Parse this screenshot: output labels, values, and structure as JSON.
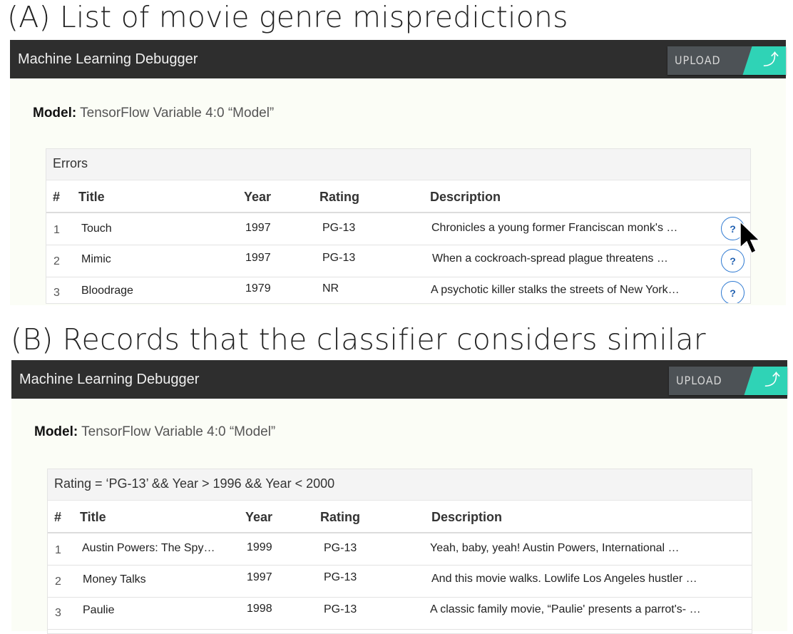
{
  "panels": [
    {
      "caption": "(A) List of movie genre mispredictions",
      "app_title": "Machine Learning Debugger",
      "upload_label": "UPLOAD",
      "upload_icon": "upload-arrow-icon",
      "model_label": "Model:",
      "model_value": "TensorFlow Variable 4:0 “Model”",
      "table": {
        "caption": "Errors",
        "columns": [
          "#",
          "Title",
          "Year",
          "Rating",
          "Description"
        ],
        "rows": [
          {
            "num": "1",
            "title": "Touch",
            "year": "1997",
            "rating": "PG-13",
            "description": "Chronicles a young former Franciscan monk's …",
            "action": "?"
          },
          {
            "num": "2",
            "title": "Mimic",
            "year": "1997",
            "rating": "PG-13",
            "description": "When a cockroach-spread plague threatens …",
            "action": "?"
          },
          {
            "num": "3",
            "title": "Bloodrage",
            "year": "1979",
            "rating": "NR",
            "description": "A psychotic killer stalks the streets of New York…",
            "action": "?"
          }
        ]
      }
    },
    {
      "caption": "(B) Records that the classifier considers similar",
      "app_title": "Machine Learning Debugger",
      "upload_label": "UPLOAD",
      "upload_icon": "upload-arrow-icon",
      "model_label": "Model:",
      "model_value": "TensorFlow Variable 4:0 “Model”",
      "table": {
        "caption": "Rating = ‘PG-13’ && Year > 1996 && Year < 2000",
        "columns": [
          "#",
          "Title",
          "Year",
          "Rating",
          "Description"
        ],
        "rows": [
          {
            "num": "1",
            "title": "Austin Powers: The Spy…",
            "year": "1999",
            "rating": "PG-13",
            "description": "Yeah, baby, yeah!  Austin Powers, International …"
          },
          {
            "num": "2",
            "title": "Money Talks",
            "year": "1997",
            "rating": "PG-13",
            "description": "And this movie walks. Lowlife Los Angeles hustler …"
          },
          {
            "num": "3",
            "title": "Paulie",
            "year": "1998",
            "rating": "PG-13",
            "description": "A classic family movie, “Paulie' presents a parrot's- …"
          }
        ]
      }
    }
  ],
  "colors": {
    "appbar": "#2e2e2e",
    "upload_accent": "#2fd3b6",
    "help_button": "#2f7ad2"
  },
  "icons": {
    "help": "question-icon",
    "cursor": "mouse-pointer-icon"
  }
}
